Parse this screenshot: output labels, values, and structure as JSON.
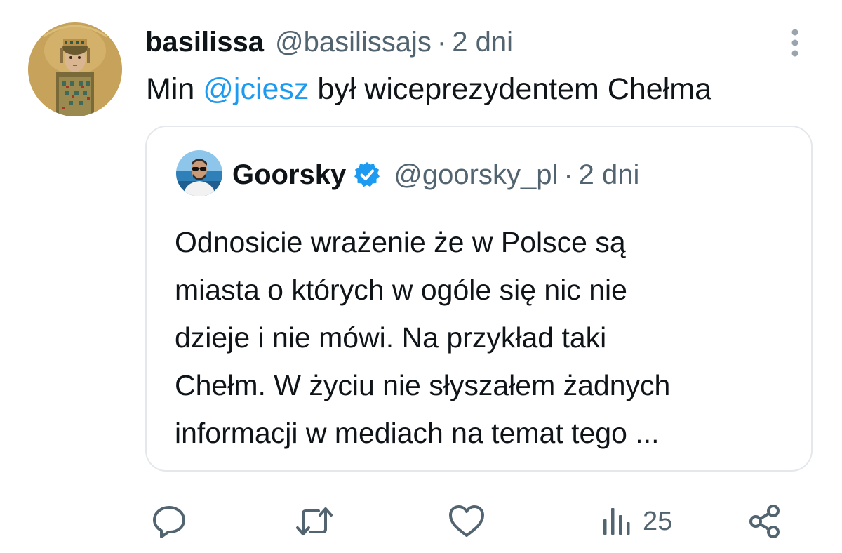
{
  "post": {
    "author": {
      "display_name": "basilissa",
      "handle": "@basilissajs",
      "avatar_icon": "mosaic-empress-avatar"
    },
    "separator": "·",
    "time": "2 dni",
    "text": {
      "before": "Min ",
      "mention": "@jciesz",
      "after": " był wiceprezydentem Chełma"
    },
    "more_icon": "vertical-ellipsis-icon"
  },
  "quote": {
    "author": {
      "display_name": "Goorsky",
      "handle": "@goorsky_pl",
      "verified_icon": "verified-badge-icon",
      "avatar_icon": "man-with-sunglasses-avatar"
    },
    "separator": "·",
    "time": "2 dni",
    "text_lines": [
      "Odnosicie wrażenie że w Polsce są",
      "miasta o których w ogóle się nic nie",
      "dzieje i nie mówi. Na przykład taki",
      "Chełm. W życiu nie słyszałem żadnych",
      "informacji w mediach na temat tego ..."
    ]
  },
  "actions": {
    "reply_icon": "reply-icon",
    "repost_icon": "repost-icon",
    "like_icon": "heart-icon",
    "views_icon": "views-chart-icon",
    "views_count": "25",
    "share_icon": "share-icon"
  },
  "colors": {
    "text": "#0f1419",
    "secondary": "#536471",
    "mention": "#1d9bf0",
    "verified": "#1d9bf0",
    "border": "#e4e8ec"
  }
}
